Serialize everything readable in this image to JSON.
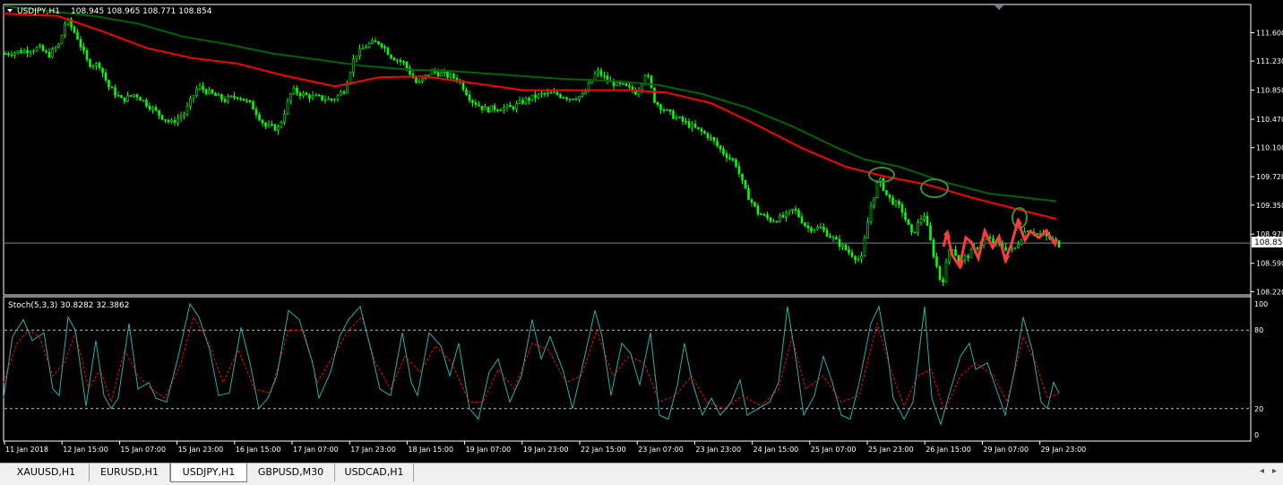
{
  "chart_title": "USDJPY,H1",
  "ohlc_readout": "108.945 108.965 108.771 108.854",
  "indicator_label": "Stoch(5,3,3) 30.8282 32.3862",
  "colors": {
    "background": "#000000",
    "frame": "#ffffff",
    "candle": "#00ff00",
    "ma_fast": "#ff0000",
    "ma_slow": "#006400",
    "stoch_main": "#20b2aa",
    "stoch_signal": "#ff0000",
    "current_price_line": "#778899",
    "annotation_ellipse": "#3d8b3d",
    "annotation_arrow": "#ff3b3b"
  },
  "price_axis": {
    "ticks": [
      "111.600",
      "111.230",
      "110.850",
      "110.470",
      "110.100",
      "109.720",
      "109.350",
      "108.970",
      "108.590",
      "108.220"
    ],
    "current_price": "108.854"
  },
  "stoch_axis": {
    "ticks": [
      "100",
      "80",
      "20",
      "0"
    ]
  },
  "time_axis": {
    "ticks": [
      "11 Jan 2018",
      "12 Jan 15:00",
      "15 Jan 07:00",
      "15 Jan 23:00",
      "16 Jan 15:00",
      "17 Jan 07:00",
      "17 Jan 23:00",
      "18 Jan 15:00",
      "19 Jan 07:00",
      "19 Jan 23:00",
      "22 Jan 15:00",
      "23 Jan 07:00",
      "23 Jan 23:00",
      "24 Jan 15:00",
      "25 Jan 07:00",
      "25 Jan 23:00",
      "26 Jan 15:00",
      "29 Jan 07:00",
      "29 Jan 23:00"
    ]
  },
  "tabs": [
    {
      "label": "XAUUSD,H1",
      "active": false
    },
    {
      "label": "EURUSD,H1",
      "active": false
    },
    {
      "label": "USDJPY,H1",
      "active": true
    },
    {
      "label": "GBPUSD,M30",
      "active": false
    },
    {
      "label": "USDCAD,H1",
      "active": false
    }
  ],
  "chart_data": {
    "type": "line",
    "price_ylim": [
      108.2,
      111.77
    ],
    "stoch_ylim": [
      0,
      100
    ],
    "stoch_levels": [
      80,
      20
    ],
    "close_path": [
      [
        0,
        111.33
      ],
      [
        18,
        111.36
      ],
      [
        38,
        111.4
      ],
      [
        48,
        111.3
      ],
      [
        60,
        111.45
      ],
      [
        68,
        111.78
      ],
      [
        80,
        111.55
      ],
      [
        92,
        111.2
      ],
      [
        105,
        111.18
      ],
      [
        115,
        110.9
      ],
      [
        130,
        110.72
      ],
      [
        145,
        110.8
      ],
      [
        160,
        110.65
      ],
      [
        175,
        110.5
      ],
      [
        185,
        110.42
      ],
      [
        200,
        110.55
      ],
      [
        215,
        110.9
      ],
      [
        230,
        110.8
      ],
      [
        245,
        110.72
      ],
      [
        260,
        110.78
      ],
      [
        275,
        110.65
      ],
      [
        290,
        110.38
      ],
      [
        305,
        110.35
      ],
      [
        320,
        110.85
      ],
      [
        335,
        110.78
      ],
      [
        350,
        110.75
      ],
      [
        365,
        110.72
      ],
      [
        378,
        110.85
      ],
      [
        390,
        111.3
      ],
      [
        405,
        111.45
      ],
      [
        418,
        111.48
      ],
      [
        430,
        111.3
      ],
      [
        445,
        111.2
      ],
      [
        460,
        110.92
      ],
      [
        475,
        111.1
      ],
      [
        490,
        111.05
      ],
      [
        505,
        111.0
      ],
      [
        520,
        110.72
      ],
      [
        535,
        110.6
      ],
      [
        550,
        110.62
      ],
      [
        565,
        110.62
      ],
      [
        580,
        110.72
      ],
      [
        600,
        110.8
      ],
      [
        615,
        110.8
      ],
      [
        630,
        110.75
      ],
      [
        645,
        110.78
      ],
      [
        660,
        111.1
      ],
      [
        675,
        110.95
      ],
      [
        690,
        110.9
      ],
      [
        705,
        110.82
      ],
      [
        715,
        111.1
      ],
      [
        725,
        110.7
      ],
      [
        740,
        110.55
      ],
      [
        755,
        110.45
      ],
      [
        770,
        110.35
      ],
      [
        785,
        110.25
      ],
      [
        800,
        110.05
      ],
      [
        815,
        109.9
      ],
      [
        825,
        109.55
      ],
      [
        840,
        109.25
      ],
      [
        855,
        109.15
      ],
      [
        870,
        109.2
      ],
      [
        880,
        109.3
      ],
      [
        895,
        109.05
      ],
      [
        910,
        109.05
      ],
      [
        925,
        108.9
      ],
      [
        940,
        108.75
      ],
      [
        955,
        108.62
      ],
      [
        965,
        109.3
      ],
      [
        975,
        109.7
      ],
      [
        985,
        109.45
      ],
      [
        1000,
        109.3
      ],
      [
        1012,
        108.95
      ],
      [
        1025,
        109.25
      ],
      [
        1035,
        108.75
      ],
      [
        1045,
        108.3
      ],
      [
        1055,
        108.85
      ],
      [
        1065,
        108.6
      ],
      [
        1080,
        108.75
      ],
      [
        1095,
        108.92
      ],
      [
        1110,
        108.82
      ],
      [
        1125,
        108.75
      ],
      [
        1140,
        109.05
      ],
      [
        1150,
        108.98
      ],
      [
        1165,
        108.92
      ],
      [
        1178,
        108.82
      ]
    ],
    "ma_fast": [
      [
        0,
        111.85
      ],
      [
        60,
        111.82
      ],
      [
        110,
        111.62
      ],
      [
        160,
        111.4
      ],
      [
        210,
        111.27
      ],
      [
        260,
        111.2
      ],
      [
        310,
        111.05
      ],
      [
        370,
        110.9
      ],
      [
        420,
        111.02
      ],
      [
        470,
        111.03
      ],
      [
        520,
        110.95
      ],
      [
        580,
        110.85
      ],
      [
        640,
        110.85
      ],
      [
        700,
        110.85
      ],
      [
        740,
        110.82
      ],
      [
        790,
        110.68
      ],
      [
        840,
        110.4
      ],
      [
        890,
        110.1
      ],
      [
        940,
        109.85
      ],
      [
        985,
        109.72
      ],
      [
        1030,
        109.62
      ],
      [
        1080,
        109.45
      ],
      [
        1130,
        109.3
      ],
      [
        1175,
        109.17
      ]
    ],
    "ma_slow": [
      [
        0,
        111.95
      ],
      [
        100,
        111.82
      ],
      [
        150,
        111.72
      ],
      [
        200,
        111.55
      ],
      [
        250,
        111.45
      ],
      [
        300,
        111.33
      ],
      [
        350,
        111.25
      ],
      [
        400,
        111.17
      ],
      [
        450,
        111.12
      ],
      [
        500,
        111.1
      ],
      [
        560,
        111.05
      ],
      [
        620,
        111.0
      ],
      [
        680,
        110.97
      ],
      [
        730,
        110.92
      ],
      [
        780,
        110.8
      ],
      [
        830,
        110.62
      ],
      [
        880,
        110.38
      ],
      [
        930,
        110.1
      ],
      [
        960,
        109.95
      ],
      [
        1000,
        109.85
      ],
      [
        1050,
        109.65
      ],
      [
        1100,
        109.5
      ],
      [
        1175,
        109.4
      ]
    ],
    "stoch_main": [
      [
        0,
        28
      ],
      [
        10,
        75
      ],
      [
        22,
        88
      ],
      [
        32,
        72
      ],
      [
        45,
        78
      ],
      [
        55,
        35
      ],
      [
        62,
        30
      ],
      [
        72,
        90
      ],
      [
        80,
        80
      ],
      [
        92,
        22
      ],
      [
        103,
        72
      ],
      [
        112,
        30
      ],
      [
        120,
        20
      ],
      [
        128,
        28
      ],
      [
        140,
        85
      ],
      [
        150,
        35
      ],
      [
        162,
        40
      ],
      [
        170,
        28
      ],
      [
        182,
        25
      ],
      [
        195,
        60
      ],
      [
        208,
        100
      ],
      [
        218,
        90
      ],
      [
        230,
        65
      ],
      [
        240,
        30
      ],
      [
        252,
        32
      ],
      [
        265,
        82
      ],
      [
        275,
        55
      ],
      [
        285,
        20
      ],
      [
        295,
        28
      ],
      [
        305,
        45
      ],
      [
        318,
        95
      ],
      [
        330,
        88
      ],
      [
        345,
        55
      ],
      [
        352,
        28
      ],
      [
        365,
        48
      ],
      [
        375,
        75
      ],
      [
        385,
        88
      ],
      [
        398,
        98
      ],
      [
        410,
        65
      ],
      [
        420,
        35
      ],
      [
        432,
        30
      ],
      [
        445,
        78
      ],
      [
        455,
        40
      ],
      [
        462,
        30
      ],
      [
        475,
        78
      ],
      [
        488,
        68
      ],
      [
        498,
        45
      ],
      [
        508,
        70
      ],
      [
        520,
        20
      ],
      [
        530,
        12
      ],
      [
        542,
        48
      ],
      [
        552,
        58
      ],
      [
        565,
        25
      ],
      [
        578,
        45
      ],
      [
        590,
        88
      ],
      [
        600,
        58
      ],
      [
        610,
        75
      ],
      [
        625,
        48
      ],
      [
        635,
        20
      ],
      [
        648,
        58
      ],
      [
        660,
        95
      ],
      [
        668,
        75
      ],
      [
        678,
        30
      ],
      [
        690,
        70
      ],
      [
        700,
        62
      ],
      [
        710,
        38
      ],
      [
        722,
        78
      ],
      [
        732,
        15
      ],
      [
        742,
        12
      ],
      [
        752,
        38
      ],
      [
        760,
        70
      ],
      [
        768,
        42
      ],
      [
        780,
        15
      ],
      [
        790,
        28
      ],
      [
        800,
        15
      ],
      [
        812,
        25
      ],
      [
        822,
        42
      ],
      [
        830,
        15
      ],
      [
        842,
        20
      ],
      [
        855,
        25
      ],
      [
        865,
        40
      ],
      [
        875,
        98
      ],
      [
        885,
        55
      ],
      [
        893,
        15
      ],
      [
        905,
        30
      ],
      [
        915,
        60
      ],
      [
        925,
        40
      ],
      [
        935,
        15
      ],
      [
        945,
        12
      ],
      [
        955,
        40
      ],
      [
        968,
        85
      ],
      [
        977,
        98
      ],
      [
        987,
        60
      ],
      [
        993,
        28
      ],
      [
        1005,
        12
      ],
      [
        1015,
        25
      ],
      [
        1028,
        98
      ],
      [
        1036,
        28
      ],
      [
        1046,
        8
      ],
      [
        1055,
        30
      ],
      [
        1068,
        60
      ],
      [
        1078,
        70
      ],
      [
        1085,
        50
      ],
      [
        1098,
        55
      ],
      [
        1108,
        35
      ],
      [
        1118,
        15
      ],
      [
        1128,
        48
      ],
      [
        1138,
        90
      ],
      [
        1148,
        65
      ],
      [
        1158,
        25
      ],
      [
        1165,
        20
      ],
      [
        1172,
        40
      ],
      [
        1178,
        32
      ]
    ],
    "stoch_signal": [
      [
        0,
        40
      ],
      [
        15,
        70
      ],
      [
        28,
        80
      ],
      [
        40,
        75
      ],
      [
        55,
        45
      ],
      [
        68,
        55
      ],
      [
        80,
        78
      ],
      [
        95,
        35
      ],
      [
        108,
        50
      ],
      [
        120,
        25
      ],
      [
        135,
        65
      ],
      [
        150,
        45
      ],
      [
        165,
        35
      ],
      [
        180,
        28
      ],
      [
        198,
        55
      ],
      [
        212,
        90
      ],
      [
        228,
        72
      ],
      [
        245,
        40
      ],
      [
        262,
        65
      ],
      [
        280,
        35
      ],
      [
        298,
        32
      ],
      [
        318,
        80
      ],
      [
        335,
        80
      ],
      [
        350,
        40
      ],
      [
        368,
        60
      ],
      [
        385,
        80
      ],
      [
        400,
        90
      ],
      [
        415,
        55
      ],
      [
        432,
        35
      ],
      [
        448,
        60
      ],
      [
        465,
        48
      ],
      [
        482,
        68
      ],
      [
        500,
        55
      ],
      [
        520,
        25
      ],
      [
        535,
        25
      ],
      [
        552,
        50
      ],
      [
        570,
        35
      ],
      [
        590,
        70
      ],
      [
        608,
        65
      ],
      [
        628,
        40
      ],
      [
        645,
        45
      ],
      [
        662,
        80
      ],
      [
        680,
        45
      ],
      [
        698,
        60
      ],
      [
        715,
        55
      ],
      [
        732,
        25
      ],
      [
        750,
        30
      ],
      [
        768,
        45
      ],
      [
        785,
        25
      ],
      [
        805,
        20
      ],
      [
        825,
        30
      ],
      [
        845,
        22
      ],
      [
        865,
        35
      ],
      [
        880,
        75
      ],
      [
        895,
        35
      ],
      [
        915,
        45
      ],
      [
        935,
        25
      ],
      [
        955,
        30
      ],
      [
        975,
        85
      ],
      [
        990,
        50
      ],
      [
        1005,
        22
      ],
      [
        1020,
        45
      ],
      [
        1035,
        50
      ],
      [
        1050,
        18
      ],
      [
        1068,
        45
      ],
      [
        1085,
        55
      ],
      [
        1105,
        45
      ],
      [
        1120,
        25
      ],
      [
        1138,
        75
      ],
      [
        1152,
        55
      ],
      [
        1165,
        28
      ],
      [
        1178,
        32
      ]
    ]
  }
}
